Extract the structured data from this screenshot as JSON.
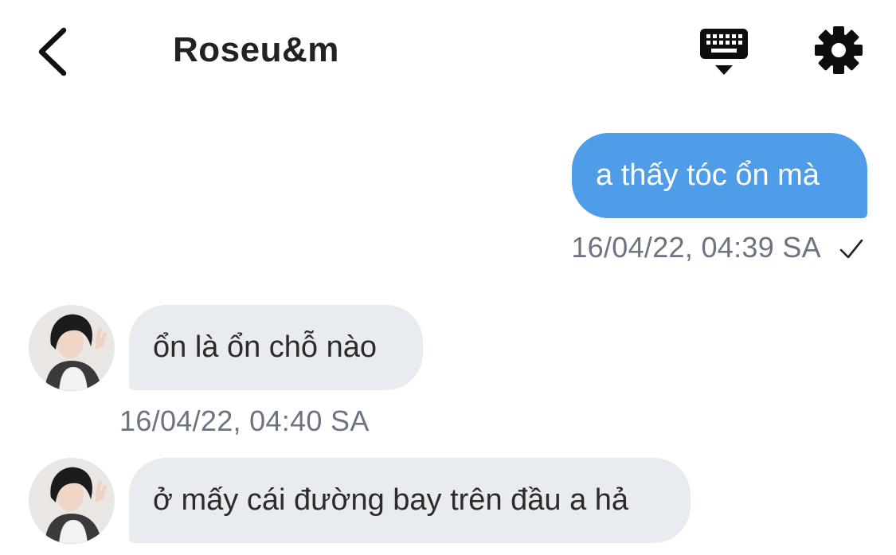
{
  "header": {
    "title": "Roseu&m",
    "back_icon": "chevron-left-icon",
    "keyboard_icon": "keyboard-hide-icon",
    "settings_icon": "gear-icon"
  },
  "colors": {
    "outgoing_bubble": "#4f9de8",
    "incoming_bubble": "#e8ebef",
    "timestamp": "#6b7480"
  },
  "messages": [
    {
      "direction": "outgoing",
      "text": "a thấy tóc ổn mà",
      "timestamp": "16/04/22, 04:39 SA",
      "status_icon": "checkmark-icon"
    },
    {
      "direction": "incoming",
      "text": "ổn là ổn chỗ nào",
      "timestamp": "16/04/22, 04:40 SA"
    },
    {
      "direction": "incoming",
      "text": "ở mấy cái đường bay trên đầu a hả"
    }
  ]
}
